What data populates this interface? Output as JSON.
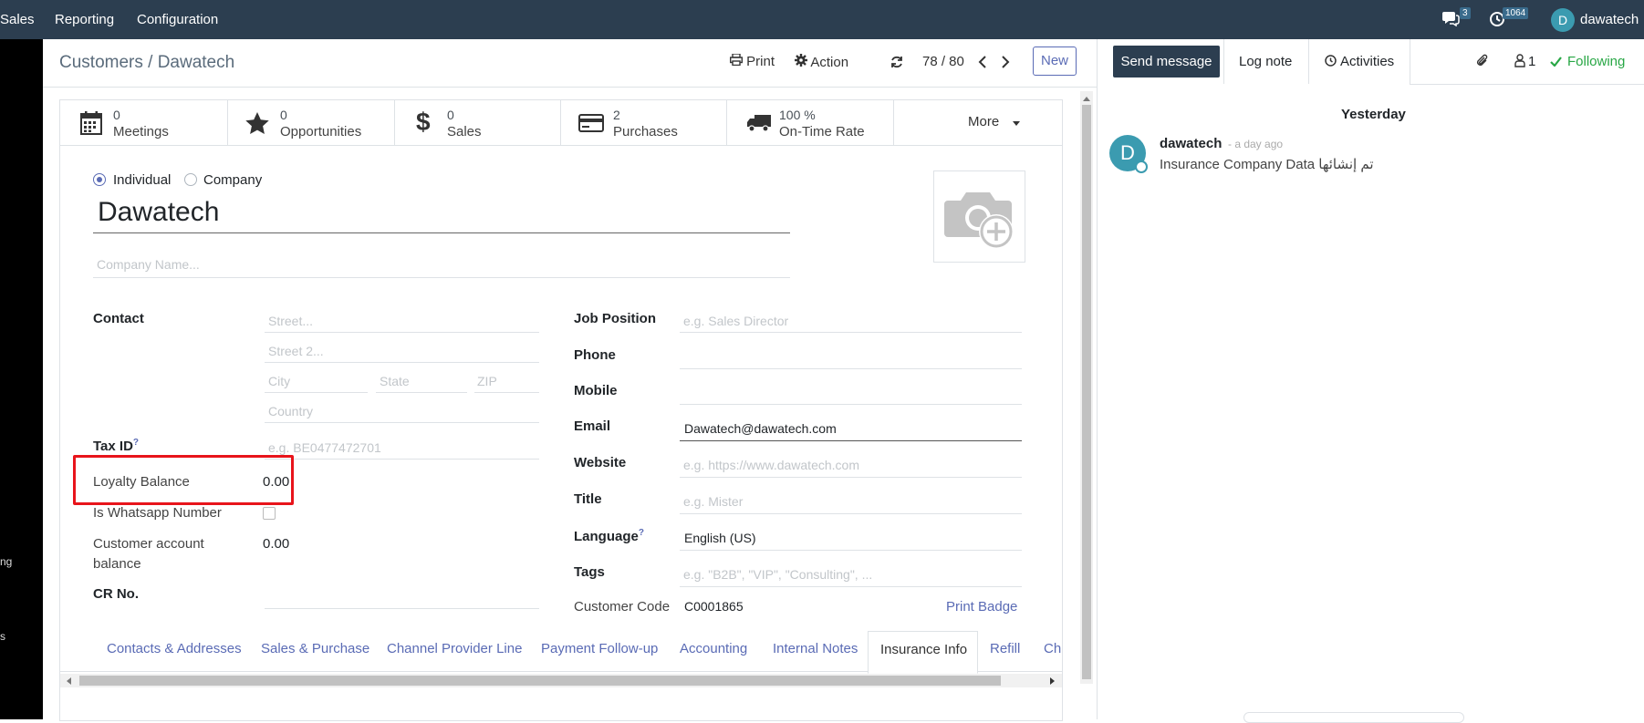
{
  "topbar": {
    "menus": [
      "Sales",
      "Reporting",
      "Configuration"
    ],
    "messages_count": "3",
    "activities_count": "1064",
    "user_initial": "D",
    "user_name": "dawatech"
  },
  "left_strip": {
    "fragments": [
      "",
      "ng",
      "s"
    ]
  },
  "control_panel": {
    "breadcrumb_parent": "Customers",
    "breadcrumb_sep": "/",
    "breadcrumb_current": "Dawatech",
    "print_label": "Print",
    "action_label": "Action",
    "pager": "78 / 80",
    "new_label": "New"
  },
  "smart_buttons": [
    {
      "value": "0",
      "label": "Meetings",
      "icon": "calendar-icon"
    },
    {
      "value": "0",
      "label": "Opportunities",
      "icon": "star-icon"
    },
    {
      "value": "0",
      "label": "Sales",
      "icon": "dollar-icon"
    },
    {
      "value": "2",
      "label": "Purchases",
      "icon": "credit-card-icon"
    },
    {
      "value": "100 %",
      "label": "On-Time Rate",
      "icon": "truck-icon"
    }
  ],
  "more_label": "More",
  "form": {
    "type_individual": "Individual",
    "type_company": "Company",
    "name": "Dawatech",
    "company_placeholder": "Company Name...",
    "contact_label": "Contact",
    "street_ph": "Street...",
    "street2_ph": "Street 2...",
    "city_ph": "City",
    "state_ph": "State",
    "zip_ph": "ZIP",
    "country_ph": "Country",
    "taxid_label": "Tax ID",
    "taxid_ph": "e.g. BE0477472701",
    "loyalty_label": "Loyalty Balance",
    "loyalty_value": "0.00",
    "whatsapp_label": "Is Whatsapp Number",
    "cab_label_1": "Customer account",
    "cab_label_2": "balance",
    "cab_value": "0.00",
    "cr_label": "CR No.",
    "job_label": "Job Position",
    "job_ph": "e.g. Sales Director",
    "phone_label": "Phone",
    "mobile_label": "Mobile",
    "email_label": "Email",
    "email_value": "Dawatech@dawatech.com",
    "website_label": "Website",
    "website_ph": "e.g. https://www.dawatech.com",
    "title_label": "Title",
    "title_ph": "e.g. Mister",
    "language_label": "Language",
    "language_value": "English (US)",
    "tags_label": "Tags",
    "tags_ph": "e.g. \"B2B\", \"VIP\", \"Consulting\", ...",
    "code_label": "Customer Code",
    "code_value": "C0001865",
    "print_badge": "Print Badge",
    "help_mark": "?"
  },
  "notebook_tabs": [
    "Contacts & Addresses",
    "Sales & Purchase",
    "Channel Provider Line",
    "Payment Follow-up",
    "Accounting",
    "Internal Notes",
    "Insurance Info",
    "Refill",
    "Ch"
  ],
  "active_tab": "Insurance Info",
  "chatter": {
    "send_message": "Send message",
    "log_note": "Log note",
    "activities": "Activities",
    "followers_count": "1",
    "following": "Following",
    "date_sep": "Yesterday",
    "author": "dawatech",
    "time": "- a day ago",
    "message_en": "Insurance Company Data",
    "message_ar": "تم إنشائها",
    "author_initial": "D"
  },
  "colors": {
    "navbar": "#2c3e50",
    "accent": "#5a6bb5",
    "highlight": "#e8141b",
    "following": "#28a745",
    "avatar": "#3b9bb0"
  }
}
